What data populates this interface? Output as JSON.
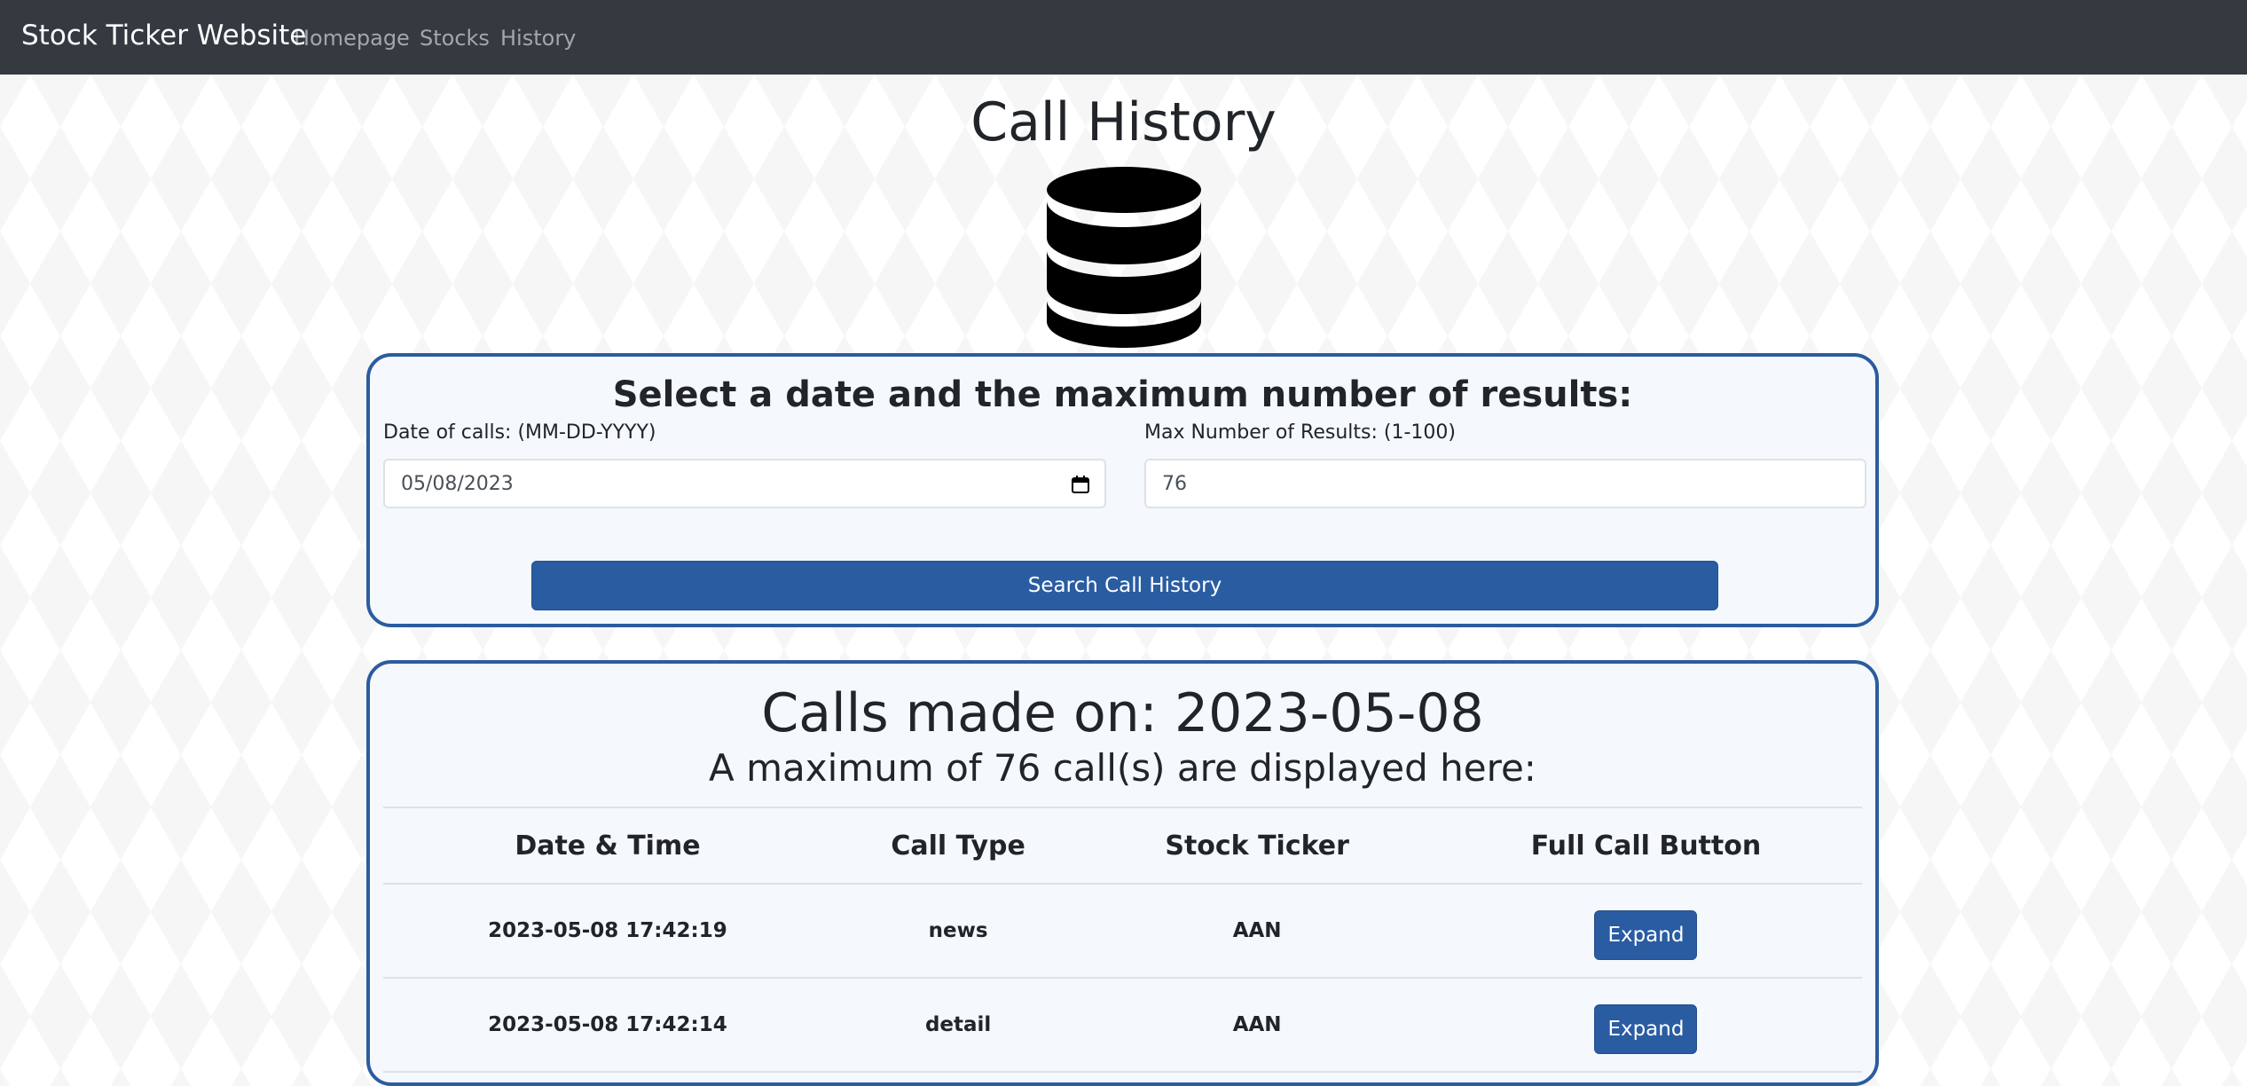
{
  "navbar": {
    "brand": "Stock Ticker Website",
    "links": [
      "Homepage",
      "Stocks",
      "History"
    ]
  },
  "header": {
    "title": "Call History",
    "icon": "database-icon"
  },
  "search_form": {
    "heading": "Select a date and the maximum number of results:",
    "date_label": "Date of calls: (MM-DD-YYYY)",
    "date_value": "05/08/2023",
    "max_label": "Max Number of Results: (1-100)",
    "max_value": "76",
    "submit_label": "Search Call History"
  },
  "results": {
    "heading": "Calls made on: 2023-05-08",
    "subheading": "A maximum of 76 call(s) are displayed here:",
    "columns": [
      "Date & Time",
      "Call Type",
      "Stock Ticker",
      "Full Call Button"
    ],
    "rows": [
      {
        "datetime": "2023-05-08 17:42:19",
        "call_type": "news",
        "ticker": "AAN",
        "button": "Expand"
      },
      {
        "datetime": "2023-05-08 17:42:14",
        "call_type": "detail",
        "ticker": "AAN",
        "button": "Expand"
      }
    ]
  },
  "colors": {
    "navbar_bg": "#343a40",
    "accent": "#2a5ca2",
    "panel_border": "#2b5c9e",
    "panel_bg": "#f5f9fd"
  }
}
